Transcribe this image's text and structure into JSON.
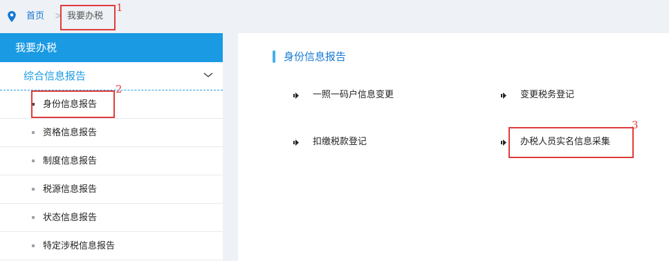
{
  "breadcrumb": {
    "home": "首页",
    "separator": ">",
    "current": "我要办税"
  },
  "annotations": [
    "1",
    "2",
    "3"
  ],
  "sidebar": {
    "title": "我要办税",
    "group": "综合信息报告",
    "items": [
      {
        "label": "身份信息报告"
      },
      {
        "label": "资格信息报告"
      },
      {
        "label": "制度信息报告"
      },
      {
        "label": "税源信息报告"
      },
      {
        "label": "状态信息报告"
      },
      {
        "label": "特定涉税信息报告"
      }
    ]
  },
  "main": {
    "section_title": "身份信息报告",
    "options": [
      {
        "label": "一照一码户信息变更"
      },
      {
        "label": "变更税务登记"
      },
      {
        "label": "扣缴税款登记"
      },
      {
        "label": "办税人员实名信息采集"
      }
    ]
  },
  "colors": {
    "accent": "#1a9ae3",
    "link": "#1479d4",
    "annotation": "#e03a3a",
    "background": "#eef1f5"
  }
}
